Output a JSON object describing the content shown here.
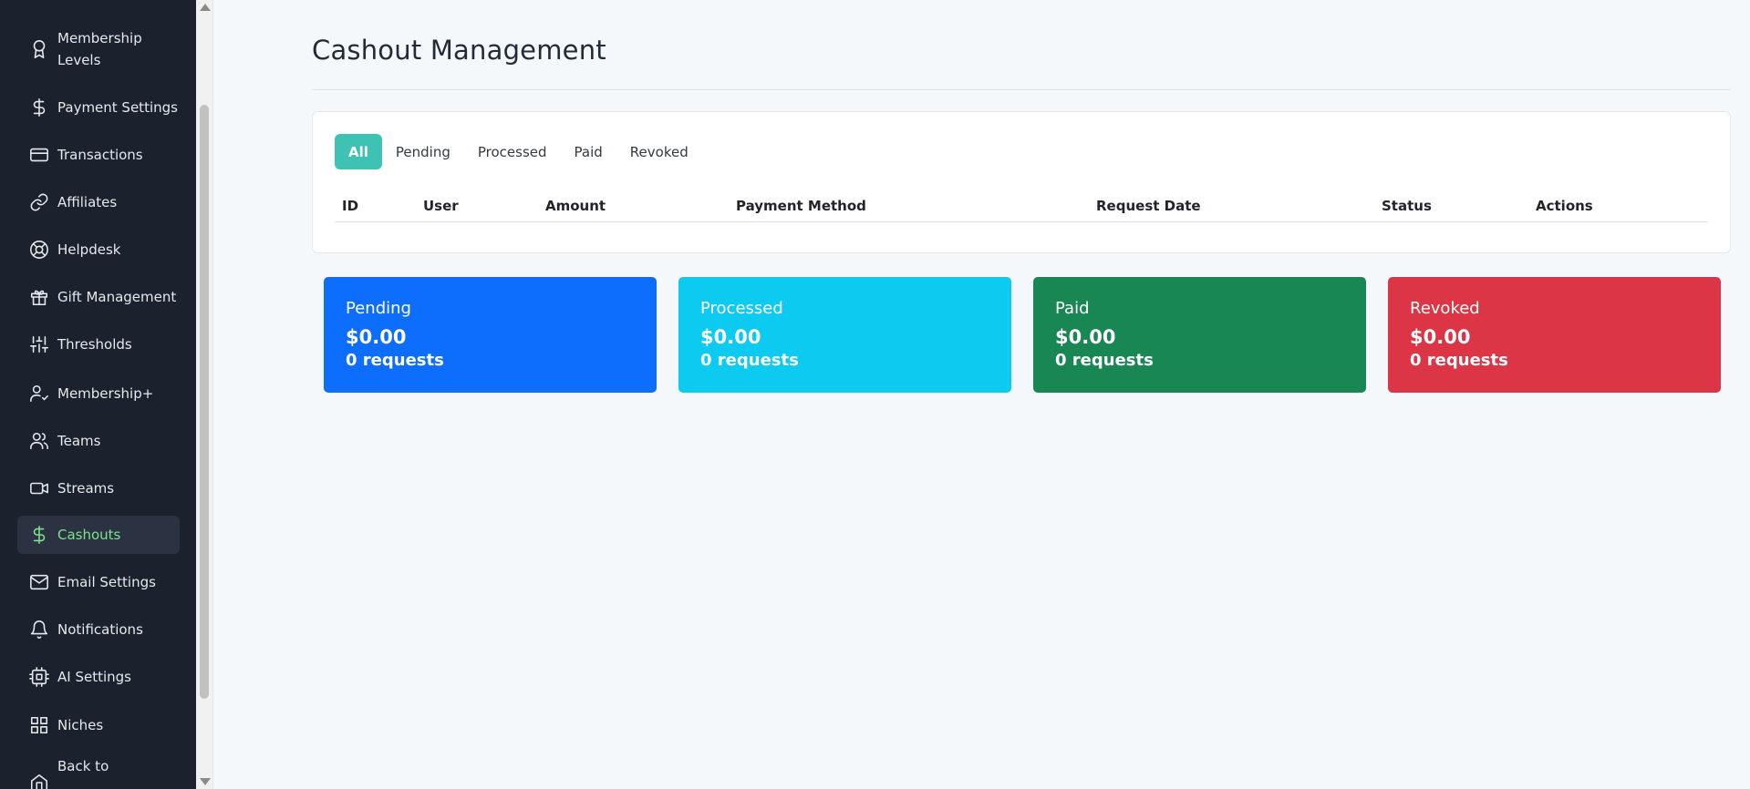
{
  "sidebar": {
    "items": [
      {
        "label": "Membership Levels",
        "icon": "award-icon"
      },
      {
        "label": "Payment Settings",
        "icon": "dollar-icon"
      },
      {
        "label": "Transactions",
        "icon": "credit-card-icon"
      },
      {
        "label": "Affiliates",
        "icon": "link-icon"
      },
      {
        "label": "Helpdesk",
        "icon": "lifebuoy-icon"
      },
      {
        "label": "Gift Management",
        "icon": "gift-icon"
      },
      {
        "label": "Thresholds",
        "icon": "sliders-icon"
      },
      {
        "label": "Membership+",
        "icon": "user-check-icon"
      },
      {
        "label": "Teams",
        "icon": "users-icon"
      },
      {
        "label": "Streams",
        "icon": "video-icon"
      },
      {
        "label": "Cashouts",
        "icon": "dollar-icon",
        "active": true
      },
      {
        "label": "Email Settings",
        "icon": "mail-icon"
      },
      {
        "label": "Notifications",
        "icon": "bell-icon"
      },
      {
        "label": "AI Settings",
        "icon": "cpu-icon"
      },
      {
        "label": "Niches",
        "icon": "grid-icon"
      },
      {
        "label": "Back to",
        "icon": "home-icon"
      }
    ],
    "active_color": "#7fe08f"
  },
  "main": {
    "title": "Cashout Management",
    "tabs": [
      {
        "label": "All",
        "active": true
      },
      {
        "label": "Pending"
      },
      {
        "label": "Processed"
      },
      {
        "label": "Paid"
      },
      {
        "label": "Revoked"
      }
    ],
    "table": {
      "columns": [
        "ID",
        "User",
        "Amount",
        "Payment Method",
        "Request Date",
        "Status",
        "Actions"
      ],
      "rows": []
    },
    "stats": [
      {
        "title": "Pending",
        "amount": "$0.00",
        "count": "0 requests",
        "color": "#0d6efd"
      },
      {
        "title": "Processed",
        "amount": "$0.00",
        "count": "0 requests",
        "color": "#0dcaf0"
      },
      {
        "title": "Paid",
        "amount": "$0.00",
        "count": "0 requests",
        "color": "#198754"
      },
      {
        "title": "Revoked",
        "amount": "$0.00",
        "count": "0 requests",
        "color": "#dc3545"
      }
    ],
    "accent": "#3ec2b4"
  }
}
